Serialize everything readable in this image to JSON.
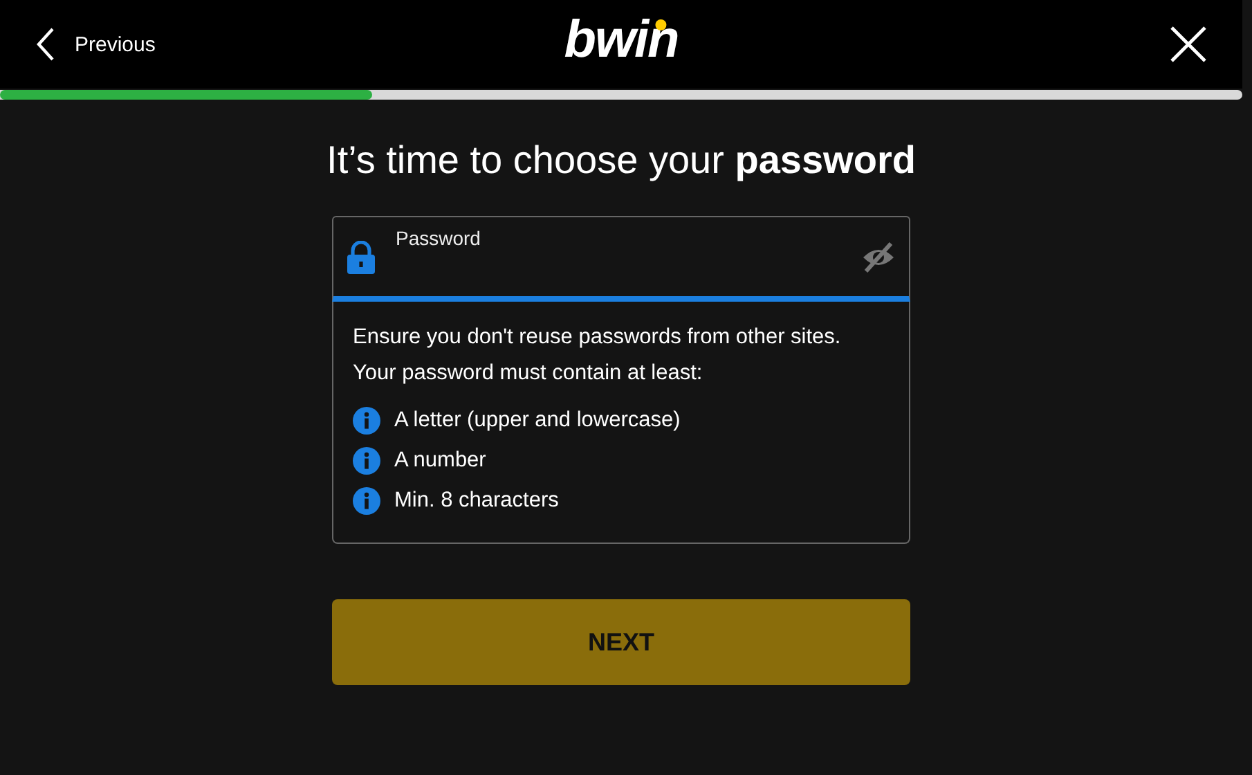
{
  "header": {
    "back_label": "Previous",
    "logo": "bwin"
  },
  "progress": {
    "level": 0.3
  },
  "title": "It’s time to choose your **password**",
  "password_field": {
    "label": "Password",
    "focused": true
  },
  "hint": {
    "lines": [
      "Ensure you don't reuse passwords from other sites.",
      "Your password must contain at least:"
    ],
    "rules": [
      {
        "text": "A letter (upper and lowercase)"
      },
      {
        "text": "A number"
      },
      {
        "text": "Min. 8 characters"
      }
    ]
  },
  "next_button": {
    "label": "NEXT",
    "disabled": true
  }
}
